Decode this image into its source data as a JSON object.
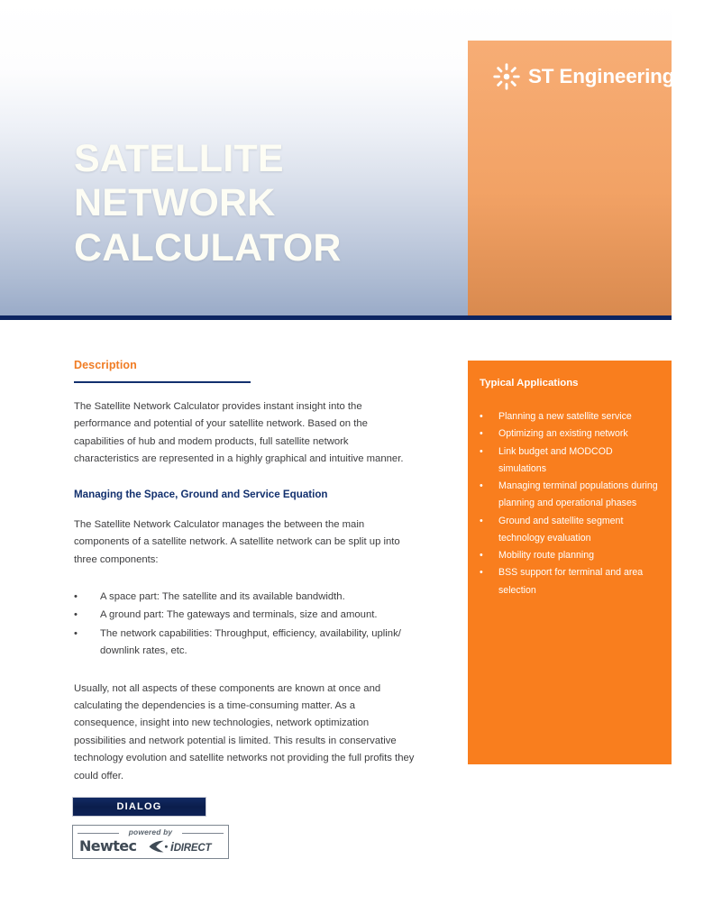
{
  "brand": {
    "logo_icon": "st-engineering-burst-icon",
    "wordmark": "ST Engineering",
    "header_orange": "#f2a265",
    "panel_orange": "#f97e1e",
    "navy": "#0c2461",
    "accent_orange": "#f07c24"
  },
  "hero": {
    "line1": "SATELLITE",
    "line2": "NETWORK",
    "line3": "CALCULATOR"
  },
  "description": {
    "heading": "Description",
    "paragraph": "The Satellite Network Calculator provides instant insight into the performance and potential of your satellite network. Based on the capabilities of hub and modem products, full satellite network characteristics are represented in a highly graphical and intuitive manner."
  },
  "managing": {
    "heading": "Managing the Space, Ground and Service Equation",
    "paragraph": "The Satellite Network Calculator manages the between the main components of a satellite network. A satellite network can be split up into three components:",
    "components": [
      "A space part: The satellite and its available bandwidth.",
      "A ground part: The gateways and terminals, size and amount.",
      "The network capabilities: Throughput, efficiency, availability, uplink/ downlink rates, etc."
    ],
    "closing_paragraph": "Usually, not all aspects of these components are known at once and calculating the dependencies is a time-consuming matter. As a consequence, insight into new technologies, network optimization possibilities and network potential is limited. This results in conservative technology evolution and satellite networks not providing the full profits they could offer.",
    "bullet_glyph": "•"
  },
  "applications": {
    "heading": "Typical Applications",
    "bullet_glyph": "•",
    "items": [
      "Planning a new satellite service",
      "Optimizing an existing network",
      "Link budget and MODCOD simulations",
      "Managing terminal populations during planning and operational phases",
      "Ground and satellite segment technology evaluation",
      "Mobility route planning",
      "BSS support for terminal and area selection"
    ]
  },
  "footer": {
    "dialog_badge": "DIALOG",
    "powered_by": "powered by",
    "newtec": "Newtec",
    "idirect_i": "i",
    "idirect_rest": "DIRECT",
    "swoosh_icon": "idirect-swoosh-icon"
  }
}
